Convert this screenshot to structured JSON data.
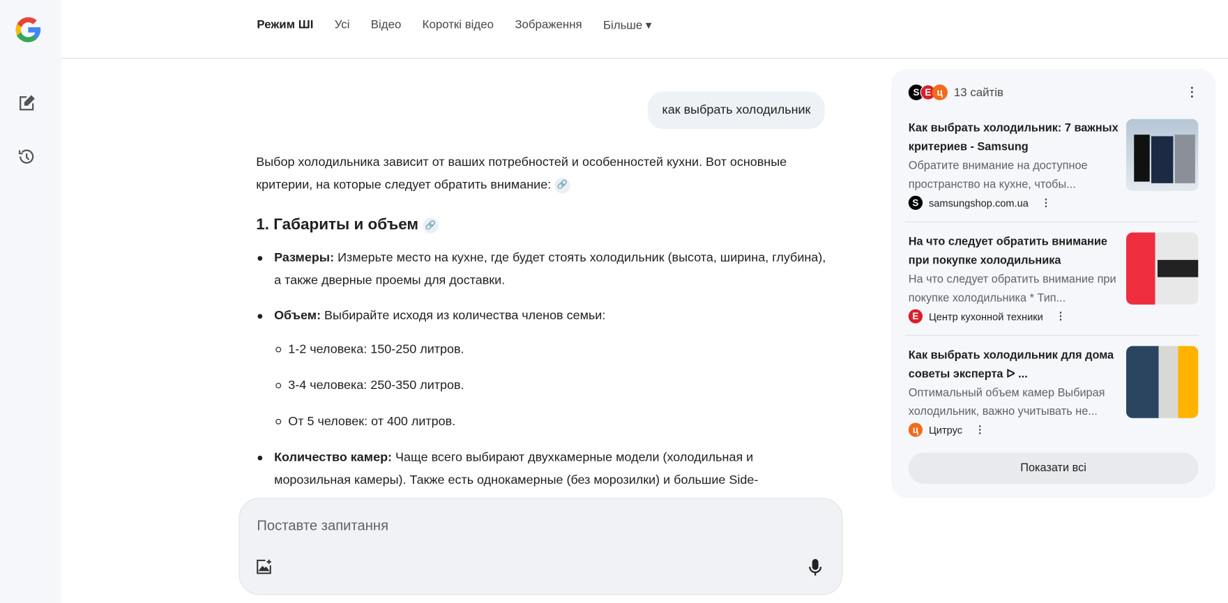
{
  "nav": {
    "tabs": [
      {
        "label": "Режим ШІ",
        "active": true
      },
      {
        "label": "Усі"
      },
      {
        "label": "Відео"
      },
      {
        "label": "Короткі відео"
      },
      {
        "label": "Зображення"
      },
      {
        "label": "Більше ▾"
      }
    ]
  },
  "query": "как выбрать холодильник",
  "answer": {
    "intro": "Выбор холодильника зависит от ваших потребностей и особенностей кухни. Вот основные критерии, на которые следует обратить внимание:",
    "section_title": "1. Габариты и объем",
    "items": [
      {
        "bold": "Размеры:",
        "text": " Измерьте место на кухне, где будет стоять холодильник (высота, ширина, глубина), а также дверные проемы для доставки."
      },
      {
        "bold": "Объем:",
        "text": " Выбирайте исходя из количества членов семьи:",
        "sub": [
          "1-2 человека: 150-250 литров.",
          "3-4 человека: 250-350 литров.",
          "От 5 человек: от 400 литров."
        ]
      },
      {
        "bold": "Количество камер:",
        "text": " Чаще всего выбирают двухкамерные модели (холодильная и морозильная камеры). Также есть однокамерные (без морозилки) и большие Side-"
      }
    ]
  },
  "input": {
    "placeholder": "Поставте запитання"
  },
  "sources": {
    "count_label": "13 сайтів",
    "cards": [
      {
        "title": "Как выбрать холодильник: 7 важных критериев - Samsung",
        "snippet": "Обратите внимание на доступное пространство на кухне, чтобы...",
        "site": "samsungshop.com.ua",
        "fav": "S",
        "fav_color": "#000000"
      },
      {
        "title": "На что следует обратить внимание при покупке холодильника",
        "snippet": "На что следует обратить внимание при покупке холодильника * Тип...",
        "site": "Центр кухонной техники",
        "fav": "E",
        "fav_color": "#d71f2b"
      },
      {
        "title": "Как выбрать холодильник для дома советы эксперта ᐅ ...",
        "snippet": "Оптимальный объем камер Выбирая холодильник, важно учитывать не...",
        "site": "Цитрус",
        "fav": "ц",
        "fav_color": "#f26a1b"
      }
    ],
    "show_all": "Показати всі"
  }
}
